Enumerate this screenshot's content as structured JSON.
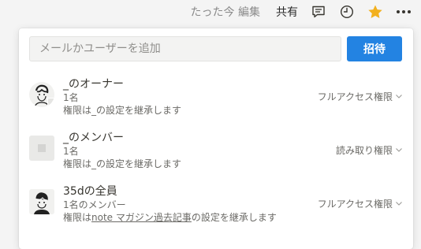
{
  "topbar": {
    "edited": "たった今 編集",
    "share": "共有",
    "icons": [
      "comment-icon",
      "clock-icon",
      "star-icon",
      "more-icon"
    ],
    "star_color": "#f2b01e"
  },
  "invite": {
    "placeholder": "メールかユーザーを追加",
    "button": "招待",
    "accent": "#2383e2"
  },
  "members": [
    {
      "name": "_のオーナー",
      "count": "1名",
      "desc_prefix": "権限は",
      "desc_link": "",
      "desc_suffix": "_の設定を継承します",
      "permission": "フルアクセス権限"
    },
    {
      "name": "_のメンバー",
      "count": "1名",
      "desc_prefix": "権限は",
      "desc_link": "",
      "desc_suffix": "_の設定を継承します",
      "permission": "読み取り権限"
    },
    {
      "name": "35dの全員",
      "count": "1名のメンバー",
      "desc_prefix": "権限は",
      "desc_link": "note マガジン過去記事",
      "desc_suffix": "の設定を継承します",
      "permission": "フルアクセス権限"
    }
  ]
}
